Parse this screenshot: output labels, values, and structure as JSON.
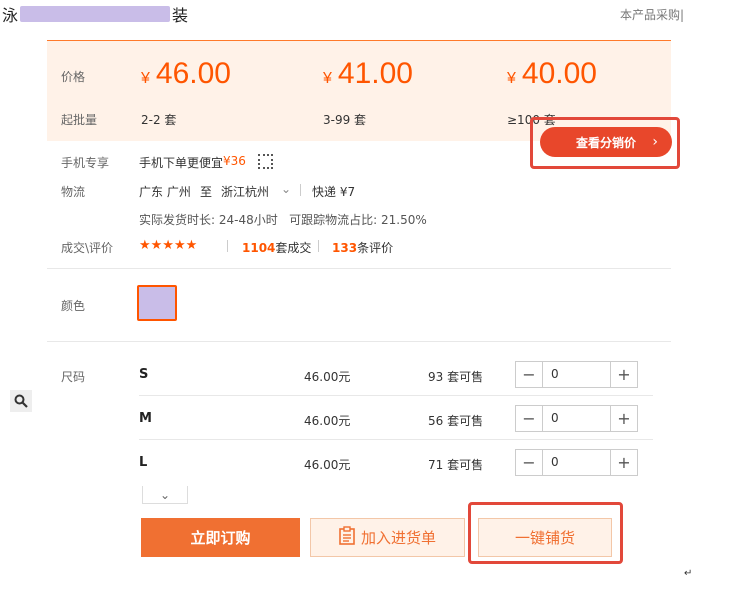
{
  "header": {
    "title_start": "泳",
    "title_end": "装",
    "top_right": "本产品采购|"
  },
  "price_panel": {
    "price_label": "价格",
    "batch_label": "起批量",
    "currency": "¥",
    "tiers": [
      {
        "price": "46.00",
        "batch": "2-2 套"
      },
      {
        "price": "41.00",
        "batch": "3-99 套"
      },
      {
        "price": "40.00",
        "batch": "≥100 套"
      }
    ]
  },
  "distribution_button": {
    "label": "查看分销价",
    "chevron": "›"
  },
  "mobile": {
    "label": "手机专享",
    "text": "手机下单更便宜",
    "price": "¥36",
    "icon": "qr-code-icon"
  },
  "logistics": {
    "label": "物流",
    "from": "广东 广州",
    "to_word": "至",
    "to": "浙江杭州",
    "express": "快递 ¥7",
    "stats": "实际发货时长: 24-48小时   可跟踪物流占比: 21.50%"
  },
  "reviews": {
    "label": "成交\\评价",
    "stars": "★★★★★",
    "deals_count": "1104",
    "deals_suffix": "套成交",
    "review_count": "133",
    "review_suffix": "条评价"
  },
  "color": {
    "label": "颜色"
  },
  "size": {
    "label": "尺码",
    "rows": [
      {
        "name": "S",
        "price": "46.00元",
        "stock": "93 套可售",
        "qty": "0"
      },
      {
        "name": "M",
        "price": "46.00元",
        "stock": "56 套可售",
        "qty": "0"
      },
      {
        "name": "L",
        "price": "46.00元",
        "stock": "71 套可售",
        "qty": "0"
      }
    ]
  },
  "actions": {
    "buy": "立即订购",
    "cart": "加入进货单",
    "one_key": "一键铺货"
  },
  "colors": {
    "accent": "#ff5500",
    "panel_bg": "#fff2e8",
    "highlight": "#e2483a"
  }
}
